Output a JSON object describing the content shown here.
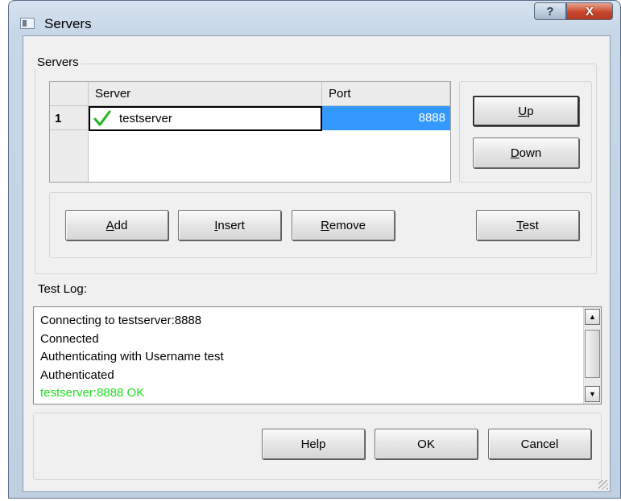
{
  "window": {
    "title": "Servers",
    "help_glyph": "?",
    "close_glyph": "X",
    "icon": "window-icon"
  },
  "servers_group": {
    "label": "Servers",
    "grid": {
      "columns": [
        "Server",
        "Port"
      ],
      "rows": [
        {
          "row_number": "1",
          "status_icon": "check-icon",
          "server": "testserver",
          "port": "8888"
        }
      ]
    },
    "buttons": {
      "up": {
        "accel": "U",
        "rest": "p"
      },
      "down": {
        "accel": "D",
        "rest": "own"
      },
      "add": {
        "accel": "A",
        "rest": "dd"
      },
      "insert": {
        "accel": "I",
        "rest": "nsert"
      },
      "remove": {
        "accel": "R",
        "rest": "emove"
      },
      "test": {
        "accel": "T",
        "rest": "est"
      }
    }
  },
  "test_log": {
    "label": "Test Log:",
    "lines": [
      "Connecting to testserver:8888",
      "Connected",
      "Authenticating with Username test",
      "Authenticated",
      "testserver:8888 OK"
    ],
    "success_color": "#22dd22"
  },
  "footer": {
    "help": "Help",
    "ok": "OK",
    "cancel": "Cancel"
  }
}
